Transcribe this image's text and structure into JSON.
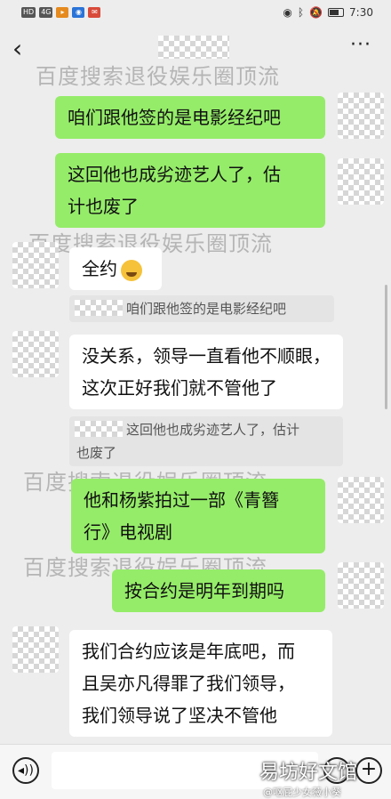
{
  "status_bar": {
    "left_badges": [
      "HD",
      "4G",
      "▸",
      "◉",
      "✉"
    ],
    "time": "7:30"
  },
  "header": {
    "back_label": "‹",
    "more_label": "···"
  },
  "watermark": "百度搜索退役娱乐圈顶流",
  "messages": [
    {
      "side": "right",
      "text": "咱们跟他签的是电影经纪吧"
    },
    {
      "side": "right",
      "text_lines": [
        "这回他也成劣迹艺人了，估",
        "计也废了"
      ]
    },
    {
      "side": "left",
      "text": "全约"
    },
    {
      "quote": "咱们跟他签的是电影经纪吧"
    },
    {
      "side": "left",
      "text_lines": [
        "没关系，领导一直看他不顺眼，",
        "这次正好我们就不管他了"
      ]
    },
    {
      "quote_lines": [
        "这回他也成劣迹艺人了，估计",
        "也废了"
      ]
    },
    {
      "side": "right",
      "text_lines": [
        "他和杨紫拍过一部《青簪",
        "行》电视剧"
      ]
    },
    {
      "side": "right",
      "text": "按合约是明年到期吗"
    },
    {
      "side": "left",
      "text_lines": [
        "我们合约应该是年底吧，而",
        "且吴亦凡得罪了我们领导，",
        "我们领导说了坚决不管他"
      ]
    }
  ],
  "bottom_bar": {
    "voice_icon": "voice-icon",
    "emoji_icon": "emoji-icon",
    "plus_icon": "plus-icon"
  },
  "corner_watermark": {
    "title": "易坊好文馆",
    "sub": "@呕屁少女薇小葵"
  }
}
